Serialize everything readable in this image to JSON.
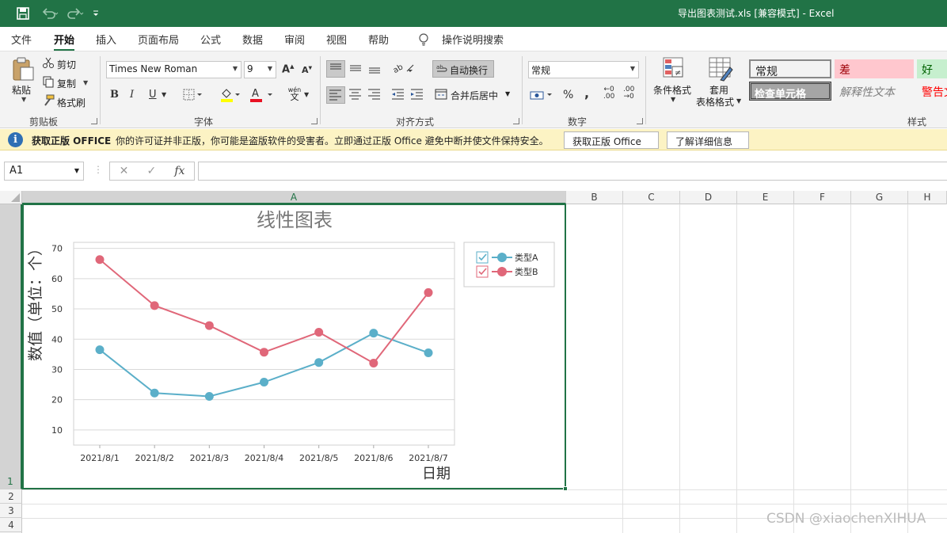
{
  "window": {
    "title": "导出图表测试.xls  [兼容模式]  -  Excel",
    "accent": "#217346"
  },
  "menu": {
    "tabs": [
      "文件",
      "开始",
      "插入",
      "页面布局",
      "公式",
      "数据",
      "审阅",
      "视图",
      "帮助"
    ],
    "active": "开始",
    "search": "操作说明搜索"
  },
  "ribbon": {
    "clipboard": {
      "paste": "粘贴",
      "cut": "剪切",
      "copy": "复制",
      "format_painter": "格式刷",
      "label": "剪贴板"
    },
    "font": {
      "name": "Times New Roman",
      "size": "9",
      "label": "字体",
      "wen": "wén",
      "wen_char": "文"
    },
    "alignment": {
      "wrap": "自动换行",
      "merge": "合并后居中",
      "label": "对齐方式"
    },
    "number": {
      "format": "常规",
      "label": "数字"
    },
    "styles": {
      "conditional": "条件格式",
      "table": "套用",
      "table2": "表格格式",
      "cells": [
        {
          "text": "常规",
          "bg": "#ffffff",
          "color": "#000000"
        },
        {
          "text": "差",
          "bg": "#ffc7ce",
          "color": "#9c0006"
        },
        {
          "text": "好",
          "bg": "#c6efce",
          "color": "#006100"
        },
        {
          "text": "检查单元格",
          "bg": "#a5a5a5",
          "color": "#ffffff"
        },
        {
          "text": "解释性文本",
          "bg": "#ffffff",
          "color": "#7f7f7f"
        },
        {
          "text": "警告文",
          "bg": "#ffffff",
          "color": "#ff0000"
        }
      ],
      "label": "样式"
    }
  },
  "infobar": {
    "title": "获取正版 OFFICE",
    "message": "你的许可证并非正版，你可能是盗版软件的受害者。立即通过正版 Office 避免中断并使文件保持安全。",
    "btn1": "获取正版 Office",
    "btn2": "了解详细信息"
  },
  "formula_bar": {
    "cell_ref": "A1",
    "fx": "fx",
    "value": ""
  },
  "columns": [
    "A",
    "B",
    "C",
    "D",
    "E",
    "F",
    "G",
    "H"
  ],
  "rows": [
    "1",
    "2",
    "3",
    "4"
  ],
  "chart_data": {
    "type": "line",
    "title": "线性图表",
    "xlabel": "日期",
    "ylabel": "数值（单位：个）",
    "categories": [
      "2021/8/1",
      "2021/8/2",
      "2021/8/3",
      "2021/8/4",
      "2021/8/5",
      "2021/8/6",
      "2021/8/7"
    ],
    "yticks": [
      10,
      20,
      30,
      40,
      50,
      60,
      70
    ],
    "ylim": [
      5,
      72
    ],
    "grid": true,
    "legend": "top-right",
    "series": [
      {
        "name": "类型A",
        "color": "#5bafc9",
        "values": [
          36.5,
          22.2,
          21.1,
          25.8,
          32.3,
          42.0,
          35.5
        ]
      },
      {
        "name": "类型B",
        "color": "#e06779",
        "values": [
          66.3,
          51.1,
          44.5,
          35.7,
          42.3,
          32.1,
          55.4
        ]
      }
    ]
  },
  "watermark": "CSDN @xiaochenXIHUA"
}
